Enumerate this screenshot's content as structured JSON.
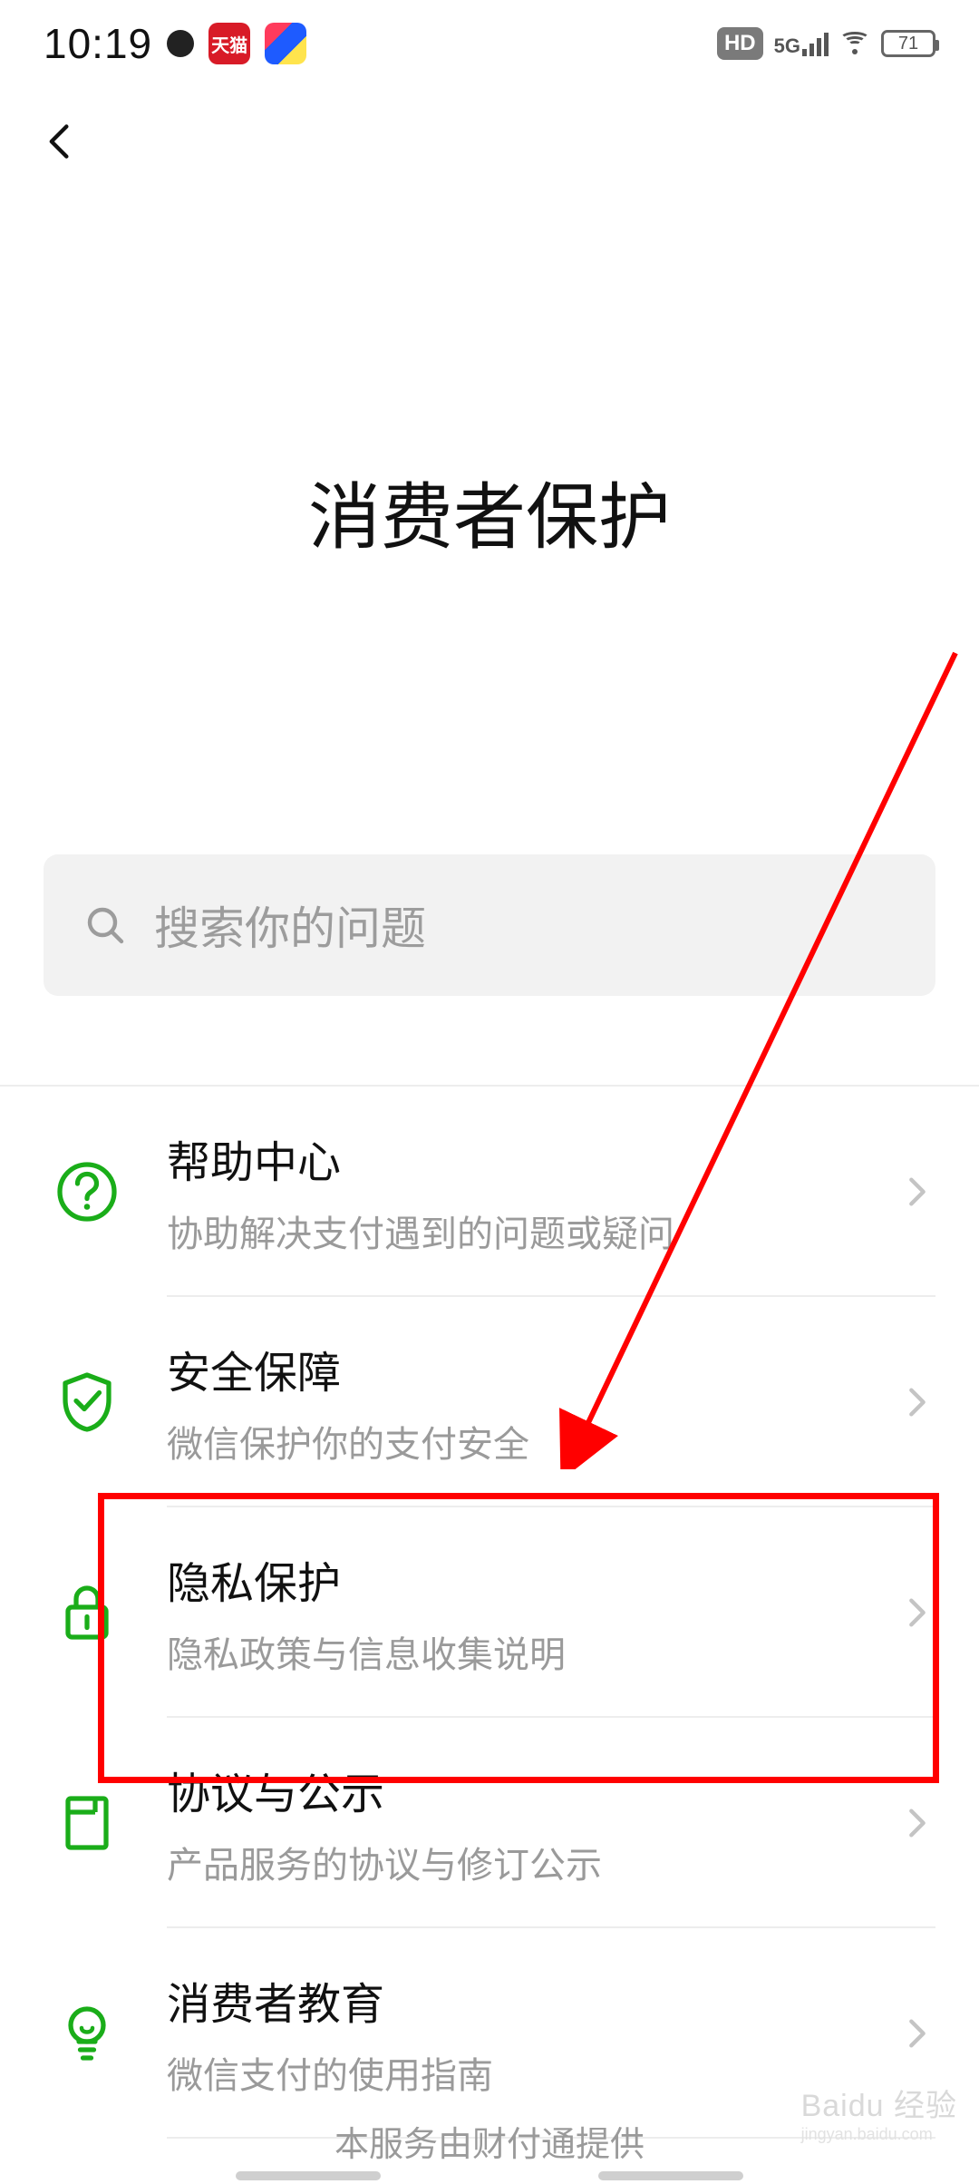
{
  "status": {
    "time": "10:19",
    "app_icon1_label": "天猫",
    "network_label": "5G",
    "hd_label": "HD",
    "battery_level": "71"
  },
  "page": {
    "title": "消费者保护"
  },
  "search": {
    "placeholder": "搜索你的问题"
  },
  "items": [
    {
      "title": "帮助中心",
      "subtitle": "协助解决支付遇到的问题或疑问"
    },
    {
      "title": "安全保障",
      "subtitle": "微信保护你的支付安全"
    },
    {
      "title": "隐私保护",
      "subtitle": "隐私政策与信息收集说明"
    },
    {
      "title": "协议与公示",
      "subtitle": "产品服务的协议与修订公示"
    },
    {
      "title": "消费者教育",
      "subtitle": "微信支付的使用指南"
    }
  ],
  "footer": {
    "provider": "本服务由财付通提供"
  },
  "watermark": {
    "brand": "Baidu 经验",
    "sub": "jingyan.baidu.com"
  },
  "colors": {
    "accent": "#1aad19",
    "highlight": "#ff0000"
  }
}
